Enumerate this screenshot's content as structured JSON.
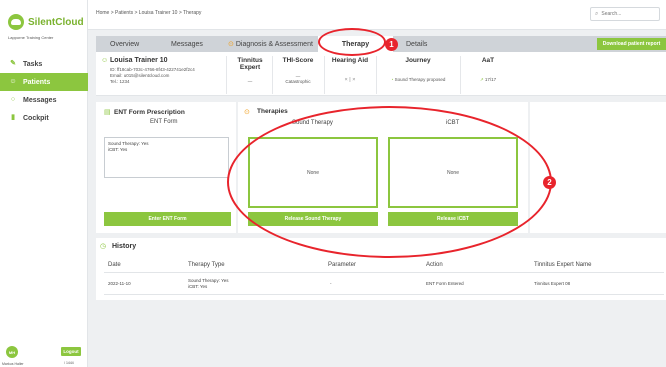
{
  "app": {
    "name": "SilentCloud",
    "subtitle": "Lapporne Training Center"
  },
  "sidebar": {
    "items": [
      {
        "label": "Tasks",
        "icon": "clipboard-icon"
      },
      {
        "label": "Patients",
        "icon": "patients-icon"
      },
      {
        "label": "Messages",
        "icon": "messages-icon"
      },
      {
        "label": "Cockpit",
        "icon": "chart-icon"
      }
    ],
    "user_initials": "MH",
    "user_name": "Markus Haller",
    "logout_label": "Logout",
    "logout_sub": "/ 1444"
  },
  "header": {
    "breadcrumb": "Home > Patients > Louisa Trainer 10 > Therapy",
    "search_placeholder": "Search..."
  },
  "tabs": [
    {
      "label": "Overview"
    },
    {
      "label": "Messages"
    },
    {
      "label": "Diagnosis & Assessment"
    },
    {
      "label": "Therapy"
    },
    {
      "label": "Details"
    }
  ],
  "download_label": "Download patient report",
  "patient": {
    "name": "Louisa Trainer 10",
    "id": "ID: ff18cab-703c-4766-8f43-422741e2f2c4",
    "email": "Email: u015@silentcloud.com",
    "tel": "Tel.: 1234",
    "cols": [
      {
        "header": "Tinnitus Expert",
        "value": "—"
      },
      {
        "header": "THI-Score",
        "value": "—",
        "value2": "Catastrophic"
      },
      {
        "header": "Hearing Aid",
        "value": "×  |  ×"
      },
      {
        "header": "Journey",
        "value": "Sound Therapy proposed"
      },
      {
        "header": "AaT",
        "value": "17/17"
      }
    ]
  },
  "ent": {
    "title": "ENT Form Prescription",
    "subtitle": "ENT Form",
    "line1": "Sound Therapy: Yes",
    "line2": "iCBT: Yes",
    "button": "Enter ENT Form"
  },
  "therapies": {
    "title": "Therapies",
    "items": [
      {
        "name": "Sound Therapy",
        "value": "None",
        "button": "Release Sound Therapy"
      },
      {
        "name": "iCBT",
        "value": "None",
        "button": "Release iCBT"
      }
    ]
  },
  "history": {
    "title": "History",
    "columns": [
      "Date",
      "Therapy Type",
      "Parameter",
      "Action",
      "Tinnitus Expert Name"
    ],
    "rows": [
      {
        "date": "2022-11-10",
        "type1": "Sound Therapy: Yes",
        "type2": "iCBT: Yes",
        "parameter": "-",
        "action": "ENT Form Entered",
        "expert": "Tinnitus Expert 08"
      }
    ]
  },
  "annotations": [
    "1",
    "2"
  ],
  "colors": {
    "accent": "#8cc63f",
    "annotation": "#e8242c",
    "warning": "#f0a020"
  }
}
